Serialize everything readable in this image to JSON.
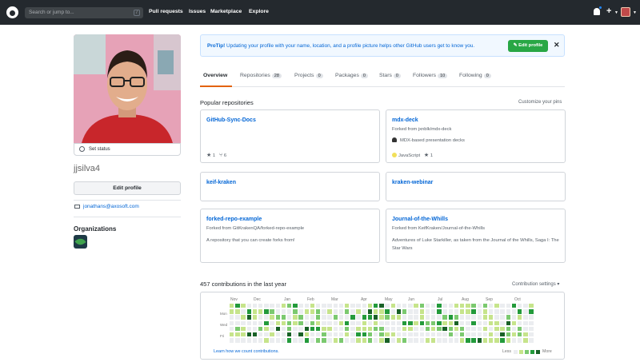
{
  "header": {
    "search_placeholder": "Search or jump to...",
    "search_hint": "/",
    "nav": [
      "Pull requests",
      "Issues",
      "Marketplace",
      "Explore"
    ],
    "new_label": "+"
  },
  "profile": {
    "set_status": "Set status",
    "username": "jjsilva4",
    "edit_profile": "Edit profile",
    "email": "jonathans@axosoft.com",
    "organizations_title": "Organizations"
  },
  "protip": {
    "label": "ProTip!",
    "text": "Updating your profile with your name, location, and a profile picture helps other GitHub users get to know you.",
    "button": "Edit profile",
    "close": "✕"
  },
  "tabs": [
    {
      "label": "Overview",
      "count": ""
    },
    {
      "label": "Repositories",
      "count": "28"
    },
    {
      "label": "Projects",
      "count": "0"
    },
    {
      "label": "Packages",
      "count": "0"
    },
    {
      "label": "Stars",
      "count": "0"
    },
    {
      "label": "Followers",
      "count": "10"
    },
    {
      "label": "Following",
      "count": "0"
    }
  ],
  "popular": {
    "title": "Popular repositories",
    "customize": "Customize your pins",
    "repos": [
      {
        "name": "GitHub-Sync-Docs",
        "fork": "",
        "desc": "",
        "stars": "1",
        "forks": "6",
        "lang": ""
      },
      {
        "name": "mdx-deck",
        "fork": "Forked from jxnblk/mdx-deck",
        "desc": "MDX-based presentation decks",
        "stars": "1",
        "forks": "",
        "lang": "JavaScript"
      },
      {
        "name": "keif-kraken",
        "fork": "",
        "desc": "",
        "stars": "",
        "forks": "",
        "lang": ""
      },
      {
        "name": "kraken-webinar",
        "fork": "",
        "desc": "",
        "stars": "",
        "forks": "",
        "lang": ""
      },
      {
        "name": "forked-repo-example",
        "fork": "Forked from GitKrakenQA/forked-repo-example",
        "desc": "A repository that you can create forks from!",
        "stars": "",
        "forks": "",
        "lang": ""
      },
      {
        "name": "Journal-of-the-Whills",
        "fork": "Forked from KeifKraken/Journal-of-the-Whills",
        "desc": "Adventures of Luke Starkiller, as taken from the Journal of the Whills, Saga I: The Star Wars",
        "stars": "",
        "forks": "",
        "lang": ""
      }
    ]
  },
  "contributions": {
    "title": "457 contributions in the last year",
    "settings": "Contribution settings ▾",
    "months": [
      "Nov",
      "Dec",
      "Jan",
      "Feb",
      "Mar",
      "Apr",
      "May",
      "Jun",
      "Jul",
      "Aug",
      "Sep",
      "Oct"
    ],
    "weekdays": [
      "Mon",
      "Wed",
      "Fri"
    ],
    "learn": "Learn how we count contributions.",
    "less": "Less",
    "more": "More",
    "colors": [
      "#ebedf0",
      "#c6e48b",
      "#7bc96f",
      "#239a3b",
      "#196127"
    ]
  }
}
